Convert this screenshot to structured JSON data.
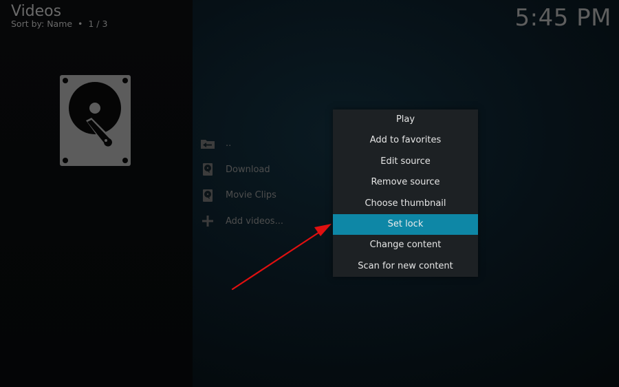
{
  "header": {
    "title": "Videos",
    "subtitle": "Sort by: Name  •  1 / 3"
  },
  "clock": "5:45 PM",
  "thumbnail": {
    "icon": "hard-drive-icon"
  },
  "list": {
    "items": [
      {
        "label": "..",
        "icon": "folder-back-icon"
      },
      {
        "label": "Download",
        "icon": "hard-drive-icon"
      },
      {
        "label": "Movie Clips",
        "icon": "hard-drive-icon"
      },
      {
        "label": "Add videos...",
        "icon": "plus-icon"
      }
    ]
  },
  "context_menu": {
    "items": [
      {
        "label": "Play",
        "active": false
      },
      {
        "label": "Add to favorites",
        "active": false
      },
      {
        "label": "Edit source",
        "active": false
      },
      {
        "label": "Remove source",
        "active": false
      },
      {
        "label": "Choose thumbnail",
        "active": false
      },
      {
        "label": "Set lock",
        "active": true
      },
      {
        "label": "Change content",
        "active": false
      },
      {
        "label": "Scan for new content",
        "active": false
      }
    ]
  },
  "colors": {
    "accent": "#0e87a6",
    "menu_bg": "#1d2124",
    "annotation_arrow": "#e01010"
  }
}
